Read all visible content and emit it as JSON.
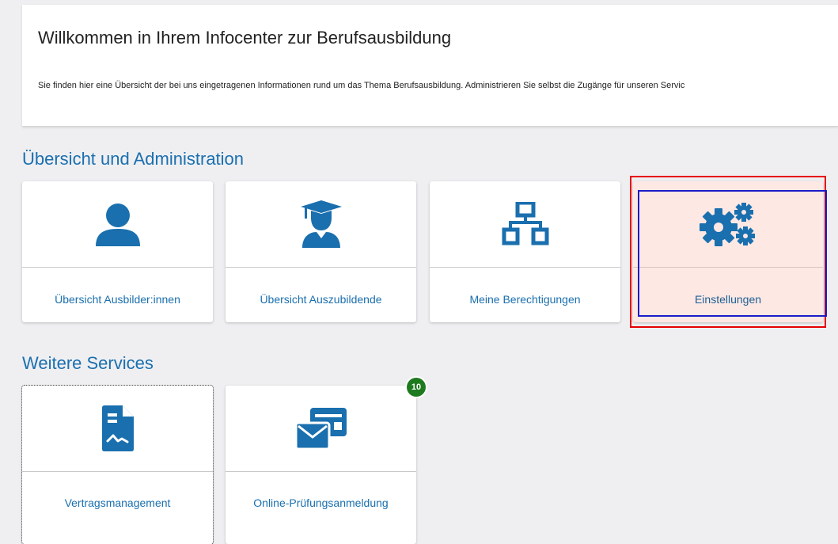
{
  "welcome": {
    "title": "Willkommen in Ihrem Infocenter zur Berufsausbildung",
    "text": "Sie finden hier eine Übersicht der bei uns eingetragenen Informationen rund um das Thema Berufsausbildung. Administrieren Sie selbst die Zugänge für unseren Servic"
  },
  "sections": {
    "admin_title": "Übersicht und Administration",
    "services_title": "Weitere Services"
  },
  "admin_tiles": [
    {
      "label": "Übersicht Ausbilder:innen",
      "icon": "user-icon"
    },
    {
      "label": "Übersicht Auszubildende",
      "icon": "graduate-icon"
    },
    {
      "label": "Meine Berechtigungen",
      "icon": "sitemap-icon"
    },
    {
      "label": "Einstellungen",
      "icon": "cogs-icon"
    }
  ],
  "service_tiles": [
    {
      "label": "Vertragsmanagement",
      "icon": "contract-icon"
    },
    {
      "label": "Online-Prüfungsanmeldung",
      "icon": "mail-card-icon",
      "badge": "10"
    }
  ],
  "colors": {
    "accent": "#1a6fae",
    "background": "#efeff2",
    "badge": "#1e7a1e",
    "selected_tile": "#fde8e4",
    "outer_highlight": "#e60000",
    "inner_highlight": "#1c1cc8"
  }
}
